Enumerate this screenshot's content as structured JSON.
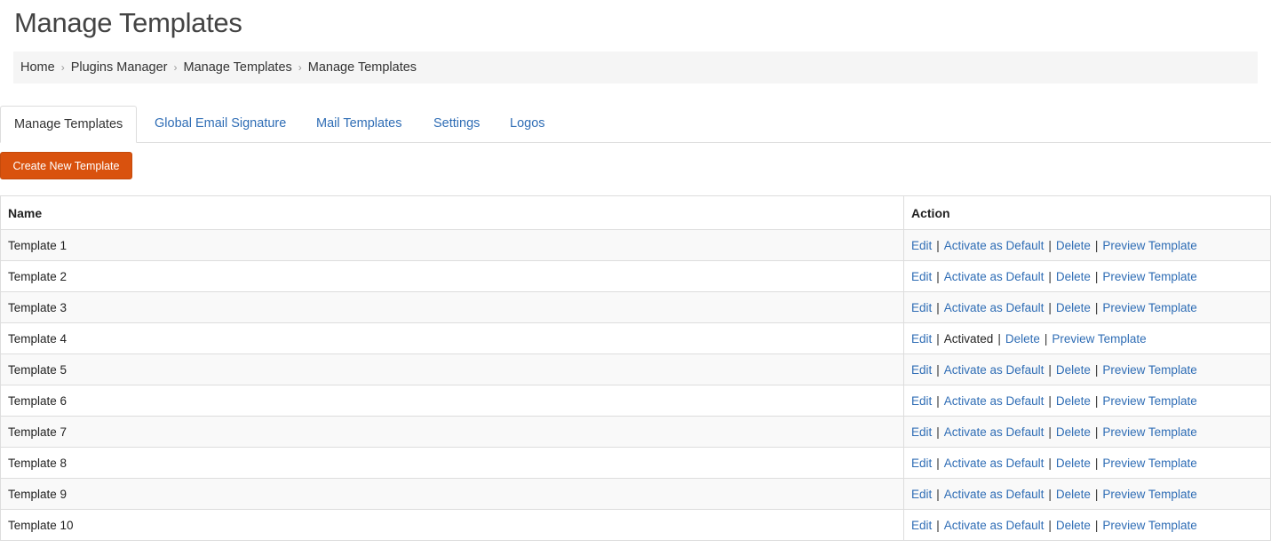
{
  "page": {
    "title": "Manage Templates"
  },
  "breadcrumb": [
    "Home",
    "Plugins Manager",
    "Manage Templates",
    "Manage Templates"
  ],
  "tabs": [
    {
      "label": "Manage Templates",
      "active": true
    },
    {
      "label": "Global Email Signature",
      "active": false
    },
    {
      "label": "Mail Templates",
      "active": false
    },
    {
      "label": "Settings",
      "active": false
    },
    {
      "label": "Logos",
      "active": false
    }
  ],
  "toolbar": {
    "create_label": "Create New Template"
  },
  "table": {
    "headers": {
      "name": "Name",
      "action": "Action"
    },
    "action_labels": {
      "edit": "Edit",
      "activate": "Activate as Default",
      "activated": "Activated",
      "delete": "Delete",
      "preview": "Preview Template",
      "separator": "|"
    },
    "rows": [
      {
        "name": "Template 1",
        "activated": false
      },
      {
        "name": "Template 2",
        "activated": false
      },
      {
        "name": "Template 3",
        "activated": false
      },
      {
        "name": "Template 4",
        "activated": true
      },
      {
        "name": "Template 5",
        "activated": false
      },
      {
        "name": "Template 6",
        "activated": false
      },
      {
        "name": "Template 7",
        "activated": false
      },
      {
        "name": "Template 8",
        "activated": false
      },
      {
        "name": "Template 9",
        "activated": false
      },
      {
        "name": "Template 10",
        "activated": false
      }
    ]
  },
  "colors": {
    "accent_button": "#d9520e",
    "link": "#2f6db5",
    "breadcrumb_bg": "#f5f5f5"
  }
}
